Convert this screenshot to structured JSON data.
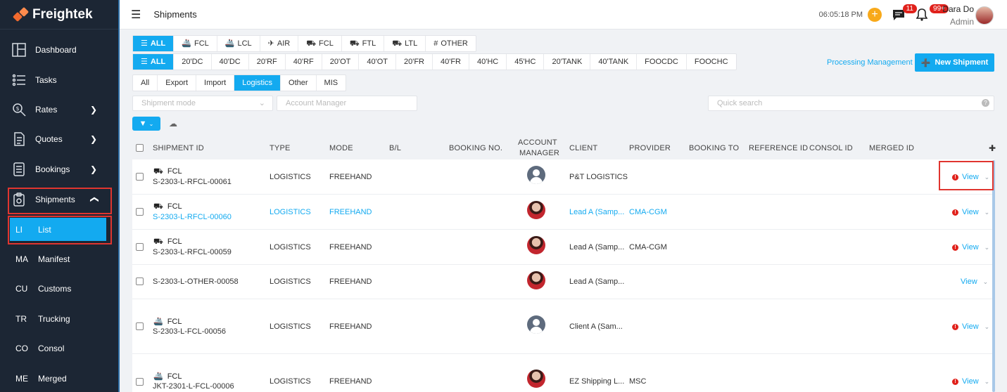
{
  "app": {
    "name": "Freightek"
  },
  "sidebar": {
    "items": [
      {
        "label": "Dashboard",
        "icon": "dashboard-icon"
      },
      {
        "label": "Tasks",
        "icon": "tasks-icon"
      },
      {
        "label": "Rates",
        "icon": "rates-icon"
      },
      {
        "label": "Quotes",
        "icon": "quotes-icon"
      },
      {
        "label": "Bookings",
        "icon": "bookings-icon"
      },
      {
        "label": "Shipments",
        "icon": "shipments-icon"
      }
    ],
    "sub_items": [
      {
        "abbr": "LI",
        "label": "List"
      },
      {
        "abbr": "MA",
        "label": "Manifest"
      },
      {
        "abbr": "CU",
        "label": "Customs"
      },
      {
        "abbr": "TR",
        "label": "Trucking"
      },
      {
        "abbr": "CO",
        "label": "Consol"
      },
      {
        "abbr": "ME",
        "label": "Merged"
      }
    ]
  },
  "topbar": {
    "title": "Shipments",
    "time": "06:05:18 PM",
    "chat_badge": "11",
    "bell_badge": "99+",
    "user_name": "Dara Do",
    "user_role": "Admin"
  },
  "mode_tabs": [
    "ALL",
    "FCL",
    "LCL",
    "AIR",
    "FCL",
    "FTL",
    "LTL",
    "OTHER"
  ],
  "container_tabs": [
    "ALL",
    "20'DC",
    "40'DC",
    "20'RF",
    "40'RF",
    "20'OT",
    "40'OT",
    "20'FR",
    "40'FR",
    "40'HC",
    "45'HC",
    "20'TANK",
    "40'TANK",
    "FOOCDC",
    "FOOCHC"
  ],
  "type_tabs": [
    "All",
    "Export",
    "Import",
    "Logistics",
    "Other",
    "MIS"
  ],
  "actions": {
    "processing": "Processing Management",
    "new_shipment": "New Shipment"
  },
  "filters": {
    "shipment_mode": "Shipment mode",
    "account_manager": "Account Manager",
    "quick_search": "Quick search"
  },
  "table": {
    "headers": {
      "shipment_id": "SHIPMENT ID",
      "type": "TYPE",
      "mode": "MODE",
      "bl": "B/L",
      "booking_no": "BOOKING NO.",
      "account_1": "ACCOUNT",
      "account_2": "MANAGER",
      "client": "CLIENT",
      "provider": "PROVIDER",
      "booking_to": "BOOKING TO",
      "reference_id": "REFERENCE ID",
      "consol_id": "CONSOL ID",
      "merged_id": "MERGED ID"
    },
    "rows": [
      {
        "mode_label": "FCL",
        "mode_icon": "truck-icon",
        "id": "S-2303-L-RFCL-00061",
        "type": "LOGISTICS",
        "mode": "FREEHAND",
        "client": "P&T LOGISTICS",
        "provider": "",
        "view": "View",
        "warn": true
      },
      {
        "mode_label": "FCL",
        "mode_icon": "truck-icon",
        "id": "S-2303-L-RFCL-00060",
        "type": "LOGISTICS",
        "mode": "FREEHAND",
        "client": "Lead A (Samp...",
        "provider": "CMA-CGM",
        "view": "View",
        "warn": true
      },
      {
        "mode_label": "FCL",
        "mode_icon": "truck-icon",
        "id": "S-2303-L-RFCL-00059",
        "type": "LOGISTICS",
        "mode": "FREEHAND",
        "client": "Lead A (Samp...",
        "provider": "CMA-CGM",
        "view": "View",
        "warn": true
      },
      {
        "mode_label": "",
        "mode_icon": "",
        "id": "S-2303-L-OTHER-00058",
        "type": "LOGISTICS",
        "mode": "FREEHAND",
        "client": "Lead A (Samp...",
        "provider": "",
        "view": "View",
        "warn": false
      },
      {
        "mode_label": "FCL",
        "mode_icon": "ship-icon",
        "id": "S-2303-L-FCL-00056",
        "type": "LOGISTICS",
        "mode": "FREEHAND",
        "client": "Client A (Sam...",
        "provider": "",
        "view": "View",
        "warn": true
      },
      {
        "mode_label": "FCL",
        "mode_icon": "ship-icon",
        "id": "JKT-2301-L-FCL-00006",
        "type": "LOGISTICS",
        "mode": "FREEHAND",
        "client": "EZ Shipping L...",
        "provider": "MSC",
        "view": "View",
        "warn": true
      }
    ]
  },
  "colors": {
    "accent": "#13aaf0",
    "sidebar_bg": "#1c2634",
    "highlight": "#e0352f",
    "warning": "#e0211b"
  }
}
